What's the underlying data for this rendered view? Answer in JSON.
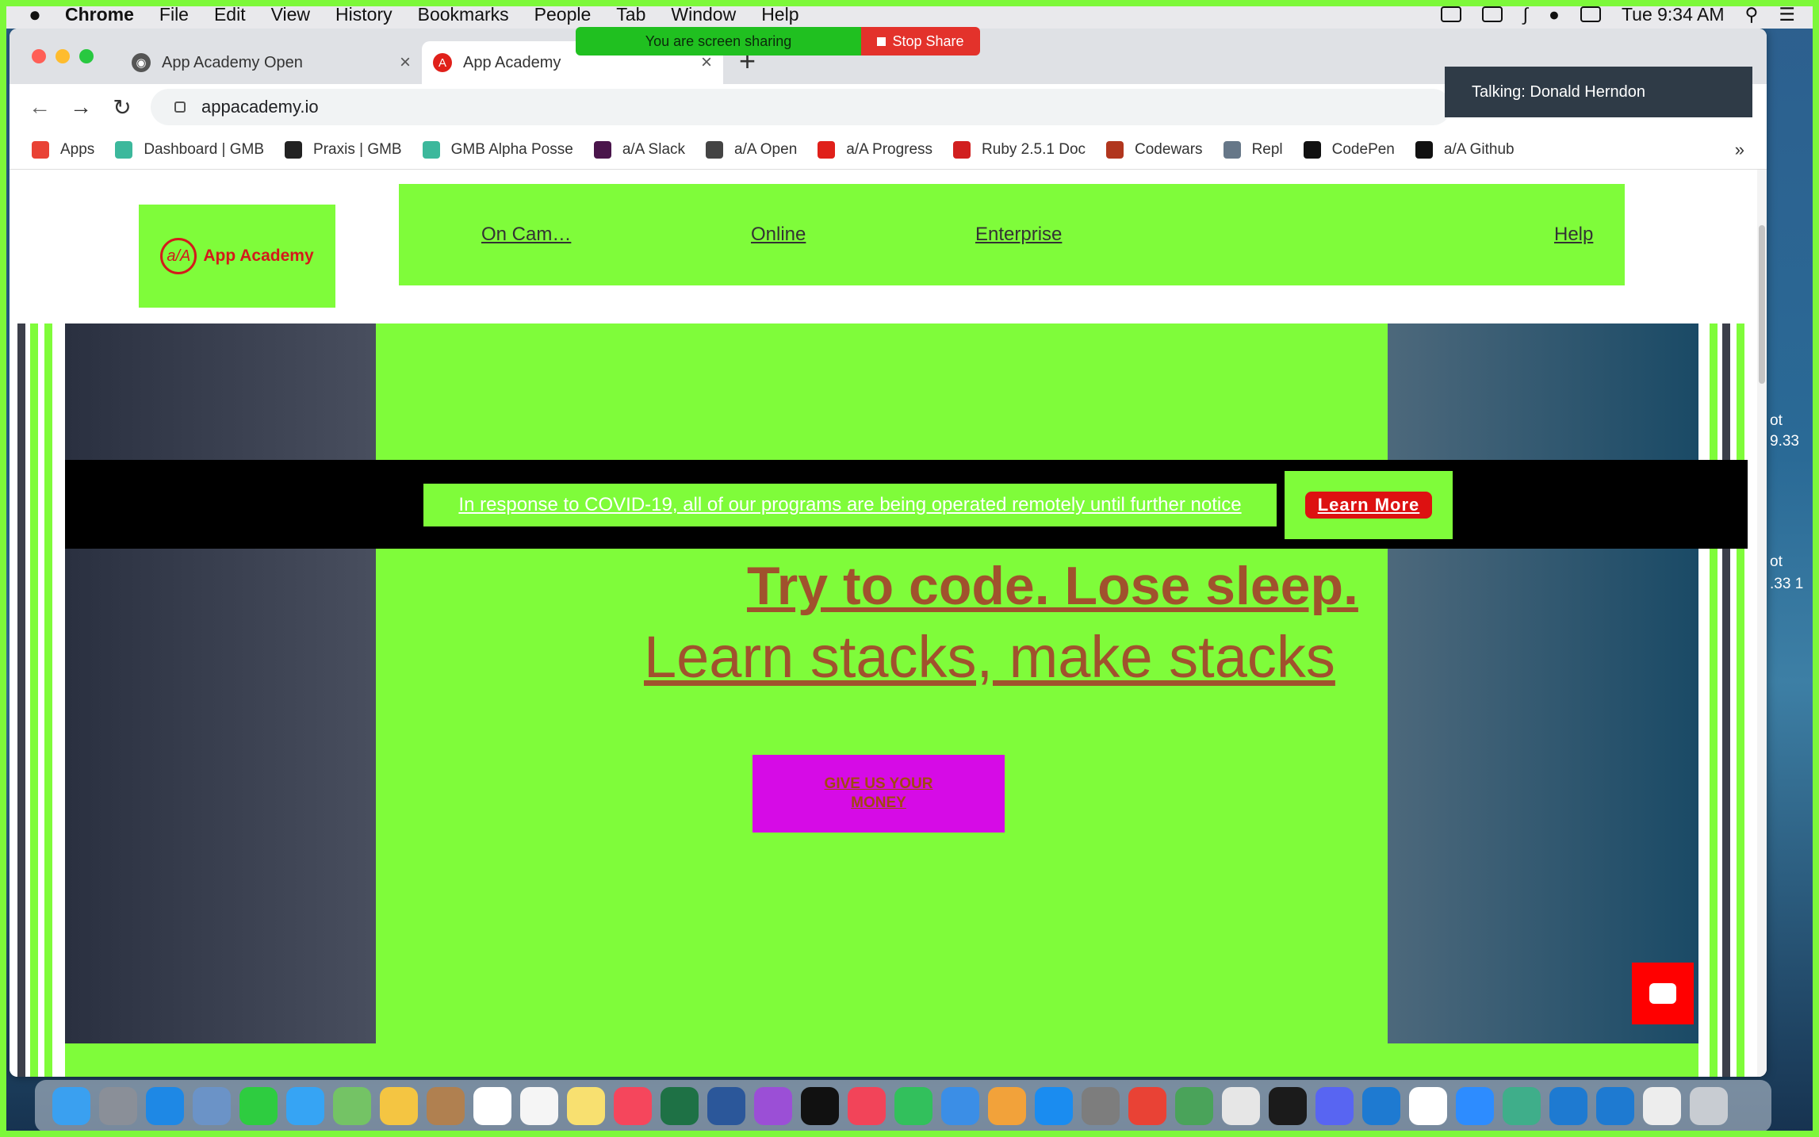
{
  "menubar": {
    "app": "Chrome",
    "items": [
      "File",
      "Edit",
      "View",
      "History",
      "Bookmarks",
      "People",
      "Tab",
      "Window",
      "Help"
    ],
    "clock": "Tue 9:34 AM"
  },
  "screen_share": {
    "status": "You are screen sharing",
    "stop": "Stop Share"
  },
  "talking": "Talking: Donald Herndon",
  "tabs": [
    {
      "title": "App Academy Open"
    },
    {
      "title": "App Academy"
    }
  ],
  "new_tab": "+",
  "url": "appacademy.io",
  "bookmarks": [
    {
      "label": "Apps",
      "color": "#e94235"
    },
    {
      "label": "Dashboard | GMB",
      "color": "#3cb89c"
    },
    {
      "label": "Praxis | GMB",
      "color": "#222222"
    },
    {
      "label": "GMB Alpha Posse",
      "color": "#3cb89c"
    },
    {
      "label": "a/A Slack",
      "color": "#4a154b"
    },
    {
      "label": "a/A Open",
      "color": "#444444"
    },
    {
      "label": "a/A Progress",
      "color": "#e0201a"
    },
    {
      "label": "Ruby 2.5.1 Doc",
      "color": "#d11f1f"
    },
    {
      "label": "Codewars",
      "color": "#b1361e"
    },
    {
      "label": "Repl",
      "color": "#667788"
    },
    {
      "label": "CodePen",
      "color": "#111111"
    },
    {
      "label": "a/A Github",
      "color": "#111111"
    }
  ],
  "bookmarks_more": "»",
  "site": {
    "logo_mark": "a/A",
    "logo_text": "App Academy",
    "nav": [
      "On Cam…",
      "Online",
      "Enterprise",
      "Help"
    ],
    "covid_message": "In response to COVID-19, all of our programs are being operated remotely until further notice",
    "covid_cta": "Learn More",
    "headline1": "Try to code. Lose sleep.",
    "headline2": "Learn stacks, make stacks",
    "cta": "GIVE US YOUR MONEY",
    "accent": "#7ffc3a",
    "cta_color": "#d60be6"
  },
  "desktop_labels": [
    "ot",
    "9.33",
    "ot",
    ".33  1"
  ],
  "dock_icons": [
    {
      "name": "finder-icon",
      "color": "#3aa0f0"
    },
    {
      "name": "launchpad-icon",
      "color": "#8a8f98"
    },
    {
      "name": "safari-icon",
      "color": "#1e88e5"
    },
    {
      "name": "preview-icon",
      "color": "#6b93c7"
    },
    {
      "name": "facetime-icon",
      "color": "#2ecc40"
    },
    {
      "name": "messages-icon",
      "color": "#36a4f4"
    },
    {
      "name": "maps-icon",
      "color": "#74c365"
    },
    {
      "name": "photos-icon",
      "color": "#f4c542"
    },
    {
      "name": "contacts-icon",
      "color": "#b08050"
    },
    {
      "name": "calendar-icon",
      "color": "#ffffff"
    },
    {
      "name": "reminders-icon",
      "color": "#f5f5f5"
    },
    {
      "name": "notes-icon",
      "color": "#f8e070"
    },
    {
      "name": "music-icon",
      "color": "#f5465c"
    },
    {
      "name": "excel-icon",
      "color": "#1e7145"
    },
    {
      "name": "word-icon",
      "color": "#2b579a"
    },
    {
      "name": "podcasts-icon",
      "color": "#9b4fd6"
    },
    {
      "name": "tv-icon",
      "color": "#111111"
    },
    {
      "name": "news-icon",
      "color": "#f24459"
    },
    {
      "name": "numbers-icon",
      "color": "#32c05c"
    },
    {
      "name": "keynote-icon",
      "color": "#3b8ee6"
    },
    {
      "name": "pages-icon",
      "color": "#f2a23a"
    },
    {
      "name": "app-store-icon",
      "color": "#1a8cf0"
    },
    {
      "name": "system-preferences-icon",
      "color": "#7d7d7d"
    },
    {
      "name": "chrome-icon",
      "color": "#e94235"
    },
    {
      "name": "sourcetree-icon",
      "color": "#4aa35a"
    },
    {
      "name": "gmb-icon",
      "color": "#e6e6e6"
    },
    {
      "name": "terminal-icon",
      "color": "#1b1b1b"
    },
    {
      "name": "discord-icon",
      "color": "#5865f2"
    },
    {
      "name": "vscode-icon",
      "color": "#1e7ad1"
    },
    {
      "name": "slack-icon",
      "color": "#ffffff"
    },
    {
      "name": "zoom-icon",
      "color": "#2d8cff"
    },
    {
      "name": "atom-icon",
      "color": "#3fae8a"
    },
    {
      "name": "vscode-insiders-icon",
      "color": "#1e7ad1"
    },
    {
      "name": "vscode-2-icon",
      "color": "#1e7ad1"
    },
    {
      "name": "archive-icon",
      "color": "#ededed"
    },
    {
      "name": "trash-icon",
      "color": "#c8ccd2"
    }
  ]
}
